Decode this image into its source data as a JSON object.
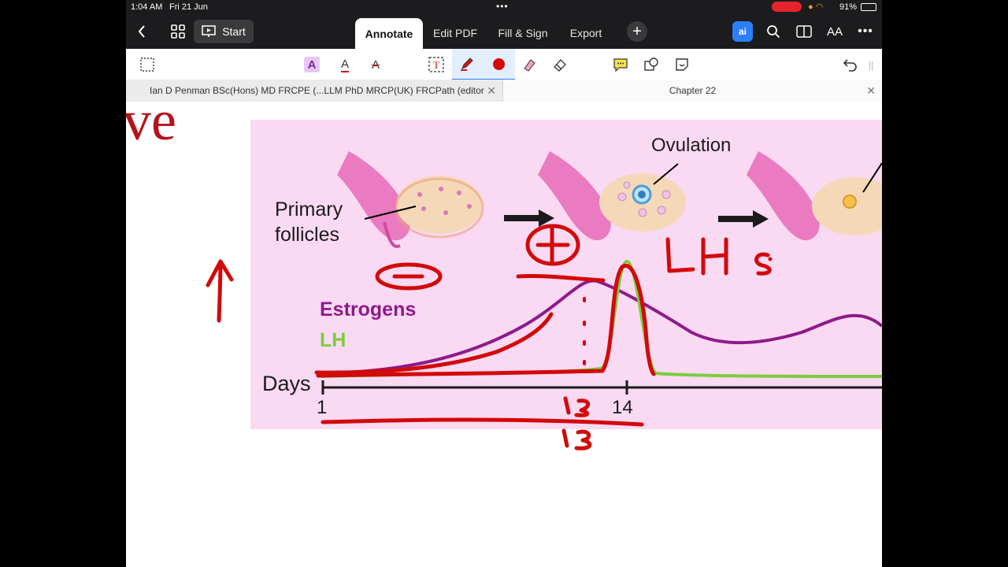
{
  "status": {
    "time": "1:04 AM",
    "date": "Fri 21 Jun",
    "battery": "91%"
  },
  "topbar": {
    "start_label": "Start",
    "tabs": [
      {
        "label": "Annotate",
        "active": true
      },
      {
        "label": "Edit PDF",
        "active": false
      },
      {
        "label": "Fill & Sign",
        "active": false
      },
      {
        "label": "Export",
        "active": false
      }
    ],
    "ai_label": "ai",
    "font_size_label": "AA"
  },
  "doc_tabs": [
    {
      "label": "Ian D Penman BSc(Hons) MD FRCPE (...LLM  PhD  MRCP(UK)  FRCPath (editor",
      "closable": true
    },
    {
      "label": "Chapter 22",
      "closable": true
    }
  ],
  "page": {
    "heading_fragment": "ve",
    "figure": {
      "label_primary": "Primary",
      "label_follicles": "follicles",
      "label_ovulation": "Ovulation",
      "legend_estrogens": "Estrogens",
      "legend_lh": "LH",
      "axis_label": "Days",
      "tick_1": "1",
      "tick_14": "14"
    },
    "handwriting": {
      "lh_surge": "LH s.",
      "day_13": "13",
      "plus": "+",
      "minus": "−"
    }
  },
  "colors": {
    "bar": "#1c1c1e",
    "accent": "#2d7ff9",
    "figure_bg": "#fad9f3",
    "estrogen": "#8e1a8a",
    "lh": "#7ccc3c",
    "ink": "#d20a0a"
  }
}
